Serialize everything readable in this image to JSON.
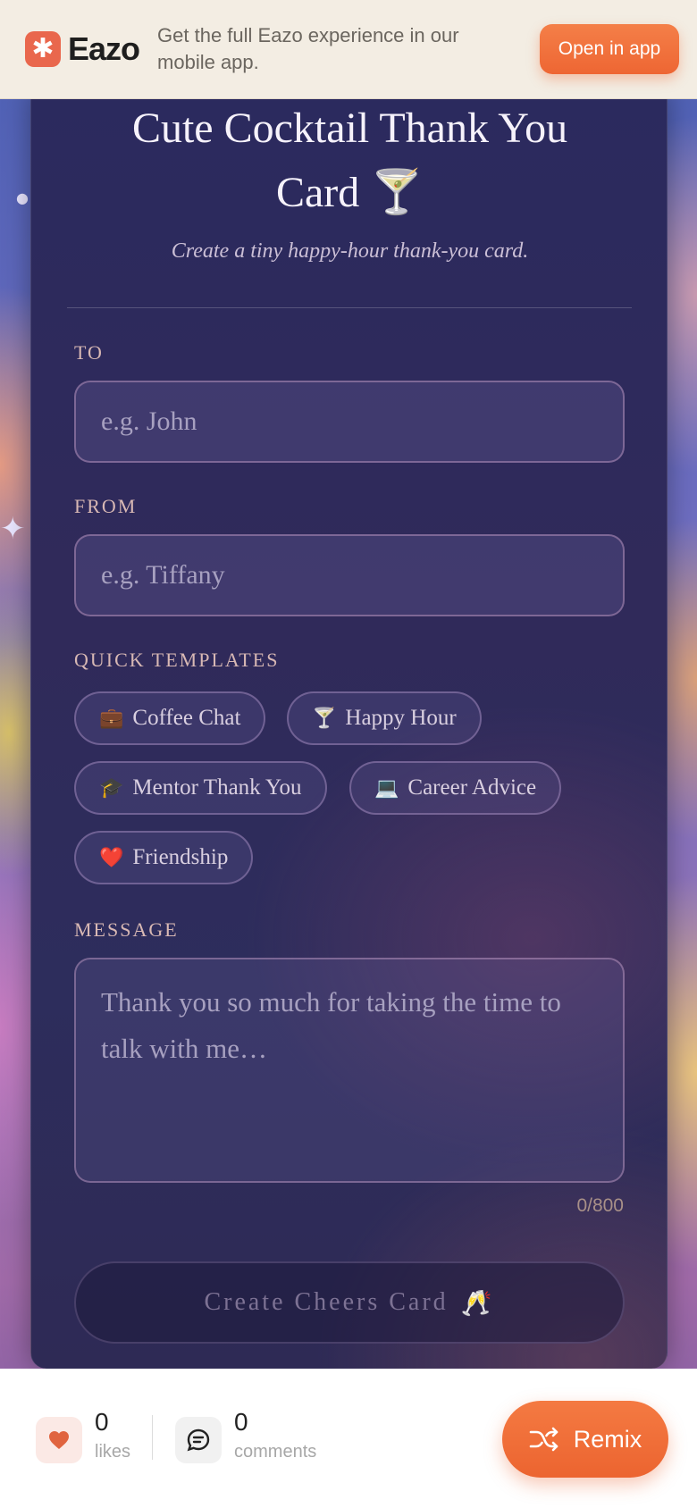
{
  "banner": {
    "logo_text": "Eazo",
    "message": "Get the full Eazo experience in our mobile app.",
    "open_button": "Open in app"
  },
  "card": {
    "title_line1": "Cute Cocktail Thank You",
    "title_line2": "Card 🍸",
    "subtitle": "Create a tiny happy-hour thank-you card.",
    "to_label": "TO",
    "to_placeholder": "e.g. John",
    "from_label": "FROM",
    "from_placeholder": "e.g. Tiffany",
    "templates_label": "QUICK TEMPLATES",
    "templates": [
      {
        "emoji": "💼",
        "label": "Coffee Chat"
      },
      {
        "emoji": "🍸",
        "label": "Happy Hour"
      },
      {
        "emoji": "🎓",
        "label": "Mentor Thank You"
      },
      {
        "emoji": "💻",
        "label": "Career Advice"
      },
      {
        "emoji": "❤️",
        "label": "Friendship"
      }
    ],
    "message_label": "MESSAGE",
    "message_placeholder": "Thank you so much for taking the time to talk with me…",
    "char_counter": "0/800",
    "create_button": "Create Cheers Card",
    "create_button_emoji": "🥂"
  },
  "footer": {
    "likes_count": "0",
    "likes_label": "likes",
    "comments_count": "0",
    "comments_label": "comments",
    "remix_button": "Remix"
  },
  "colors": {
    "accent": "#ee6633",
    "card_bg": "#2d2a5c",
    "banner_bg": "#f3ede3"
  },
  "icons": [
    "eazo-logo-icon",
    "heart-icon",
    "comment-icon",
    "shuffle-icon"
  ]
}
